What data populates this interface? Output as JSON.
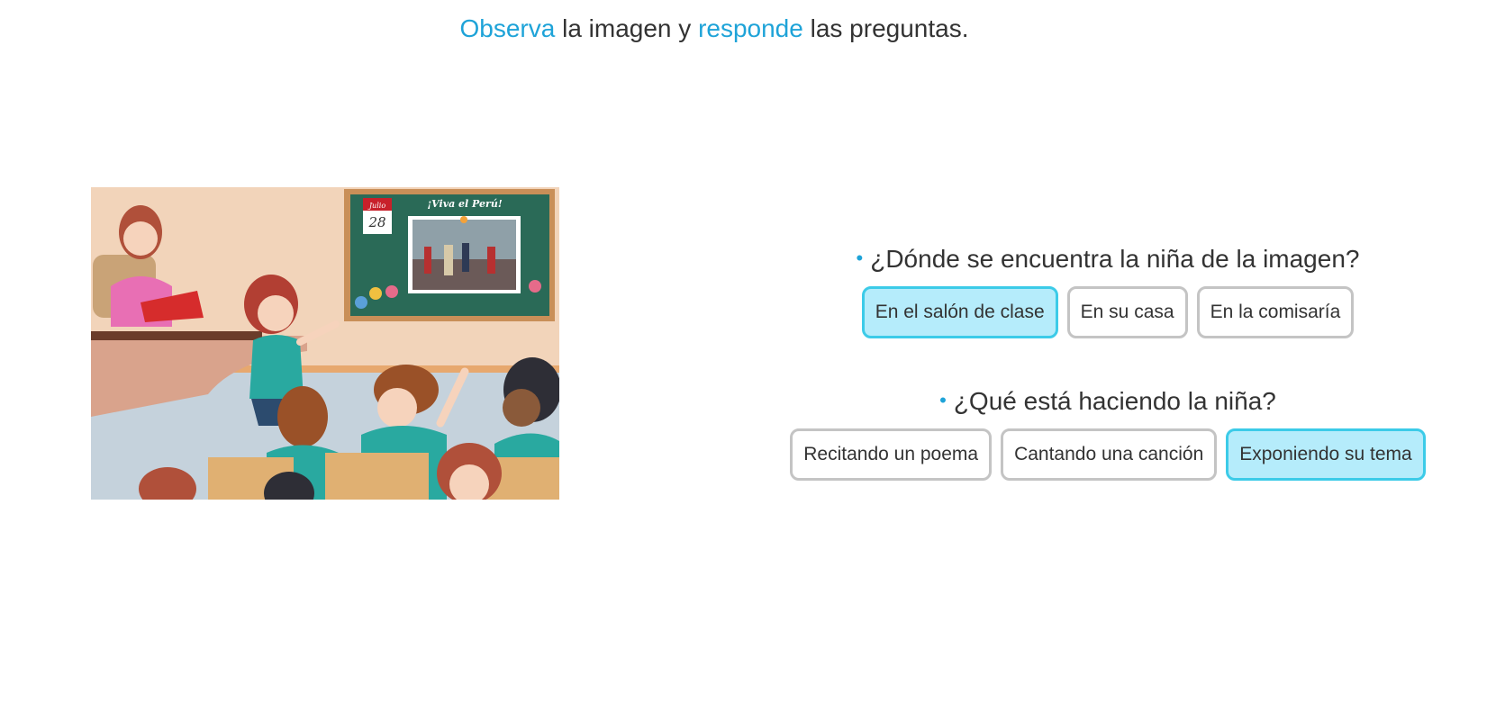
{
  "instruction": {
    "word1": "Observa",
    "text1": " la imagen y ",
    "word2": "responde",
    "text2": " las preguntas."
  },
  "scene": {
    "banner": "¡Viva el Perú!",
    "calendar_month": "Julio",
    "calendar_day": "28"
  },
  "questions": [
    {
      "bullet": "•",
      "text": "¿Dónde se encuentra la niña de la imagen?",
      "options": [
        "En el salón de clase",
        "En su casa",
        "En la comisaría"
      ],
      "selected_index": 0
    },
    {
      "bullet": "•",
      "text": "¿Qué está haciendo la niña?",
      "options": [
        "Recitando un poema",
        "Cantando una canción",
        "Exponiendo su tema"
      ],
      "selected_index": 2
    }
  ],
  "colors": {
    "accent": "#1ea3d8",
    "selected_fill": "#b5ecfb",
    "selected_border": "#3ccbe8",
    "option_border": "#c4c4c4"
  }
}
